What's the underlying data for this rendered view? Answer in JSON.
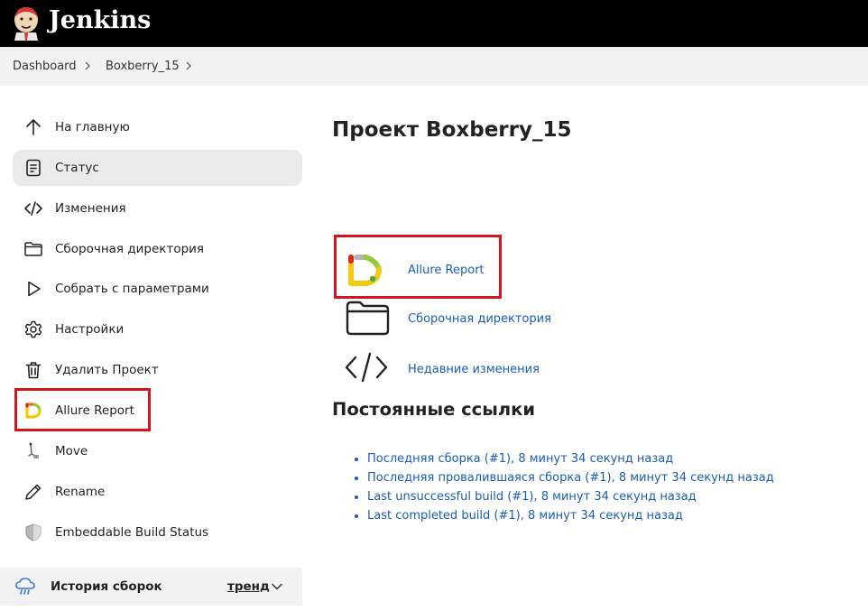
{
  "app": {
    "title": "Jenkins"
  },
  "breadcrumb": [
    "Dashboard",
    "Boxberry_15"
  ],
  "sidebar": {
    "items": [
      {
        "label": "На главную",
        "icon": "arrow-up-icon"
      },
      {
        "label": "Статус",
        "icon": "document-icon",
        "active": true
      },
      {
        "label": "Изменения",
        "icon": "code-icon"
      },
      {
        "label": "Сборочная директория",
        "icon": "folder-icon"
      },
      {
        "label": "Собрать с параметрами",
        "icon": "play-icon"
      },
      {
        "label": "Настройки",
        "icon": "gear-icon"
      },
      {
        "label": "Удалить Проект",
        "icon": "trash-icon"
      },
      {
        "label": "Allure Report",
        "icon": "allure-icon"
      },
      {
        "label": "Move",
        "icon": "move-icon"
      },
      {
        "label": "Rename",
        "icon": "pencil-icon"
      },
      {
        "label": "Embeddable Build Status",
        "icon": "shield-icon"
      }
    ]
  },
  "build_history": {
    "title": "История сборок",
    "trend": "тренд"
  },
  "main": {
    "title": "Проект Boxberry_15",
    "links": [
      {
        "label": "Allure Report",
        "icon": "allure-icon"
      },
      {
        "label": "Сборочная директория",
        "icon": "folder-icon"
      },
      {
        "label": "Недавние изменения",
        "icon": "code-icon"
      }
    ],
    "permalinks_title": "Постоянные ссылки",
    "permalinks": [
      "Последняя сборка (#1), 8 минут 34 секунд назад",
      "Последняя провалившаяся сборка (#1), 8 минут 34 секунд назад",
      "Last unsuccessful build (#1), 8 минут 34 секунд назад",
      "Last completed build (#1), 8 минут 34 секунд назад"
    ]
  },
  "colors": {
    "header": "#000000",
    "link": "#1a5db8",
    "highlight": "#d4161e",
    "active_bg": "#eaeaeb"
  }
}
